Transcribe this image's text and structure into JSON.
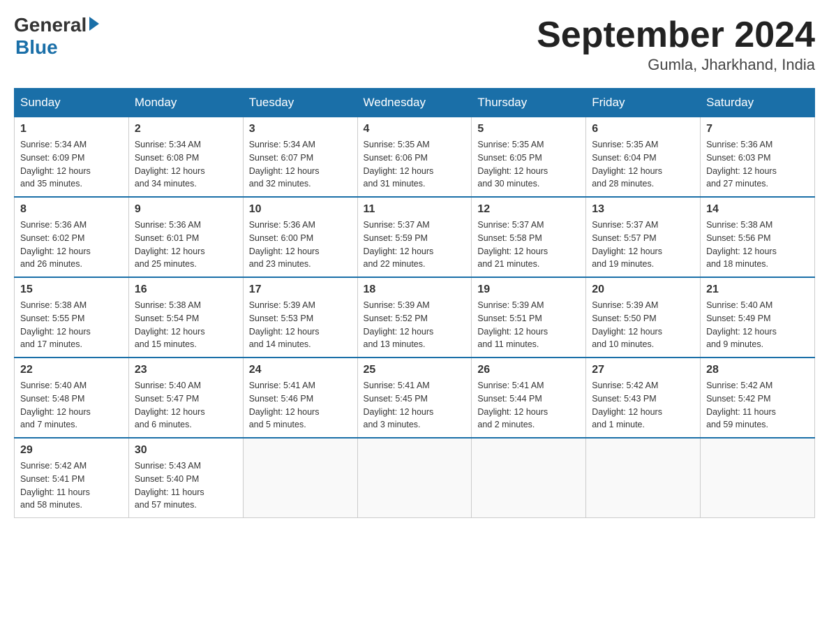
{
  "header": {
    "logo": {
      "general": "General",
      "blue": "Blue"
    },
    "title": "September 2024",
    "location": "Gumla, Jharkhand, India"
  },
  "days_of_week": [
    "Sunday",
    "Monday",
    "Tuesday",
    "Wednesday",
    "Thursday",
    "Friday",
    "Saturday"
  ],
  "weeks": [
    [
      {
        "day": "1",
        "sunrise": "5:34 AM",
        "sunset": "6:09 PM",
        "daylight": "12 hours and 35 minutes."
      },
      {
        "day": "2",
        "sunrise": "5:34 AM",
        "sunset": "6:08 PM",
        "daylight": "12 hours and 34 minutes."
      },
      {
        "day": "3",
        "sunrise": "5:34 AM",
        "sunset": "6:07 PM",
        "daylight": "12 hours and 32 minutes."
      },
      {
        "day": "4",
        "sunrise": "5:35 AM",
        "sunset": "6:06 PM",
        "daylight": "12 hours and 31 minutes."
      },
      {
        "day": "5",
        "sunrise": "5:35 AM",
        "sunset": "6:05 PM",
        "daylight": "12 hours and 30 minutes."
      },
      {
        "day": "6",
        "sunrise": "5:35 AM",
        "sunset": "6:04 PM",
        "daylight": "12 hours and 28 minutes."
      },
      {
        "day": "7",
        "sunrise": "5:36 AM",
        "sunset": "6:03 PM",
        "daylight": "12 hours and 27 minutes."
      }
    ],
    [
      {
        "day": "8",
        "sunrise": "5:36 AM",
        "sunset": "6:02 PM",
        "daylight": "12 hours and 26 minutes."
      },
      {
        "day": "9",
        "sunrise": "5:36 AM",
        "sunset": "6:01 PM",
        "daylight": "12 hours and 25 minutes."
      },
      {
        "day": "10",
        "sunrise": "5:36 AM",
        "sunset": "6:00 PM",
        "daylight": "12 hours and 23 minutes."
      },
      {
        "day": "11",
        "sunrise": "5:37 AM",
        "sunset": "5:59 PM",
        "daylight": "12 hours and 22 minutes."
      },
      {
        "day": "12",
        "sunrise": "5:37 AM",
        "sunset": "5:58 PM",
        "daylight": "12 hours and 21 minutes."
      },
      {
        "day": "13",
        "sunrise": "5:37 AM",
        "sunset": "5:57 PM",
        "daylight": "12 hours and 19 minutes."
      },
      {
        "day": "14",
        "sunrise": "5:38 AM",
        "sunset": "5:56 PM",
        "daylight": "12 hours and 18 minutes."
      }
    ],
    [
      {
        "day": "15",
        "sunrise": "5:38 AM",
        "sunset": "5:55 PM",
        "daylight": "12 hours and 17 minutes."
      },
      {
        "day": "16",
        "sunrise": "5:38 AM",
        "sunset": "5:54 PM",
        "daylight": "12 hours and 15 minutes."
      },
      {
        "day": "17",
        "sunrise": "5:39 AM",
        "sunset": "5:53 PM",
        "daylight": "12 hours and 14 minutes."
      },
      {
        "day": "18",
        "sunrise": "5:39 AM",
        "sunset": "5:52 PM",
        "daylight": "12 hours and 13 minutes."
      },
      {
        "day": "19",
        "sunrise": "5:39 AM",
        "sunset": "5:51 PM",
        "daylight": "12 hours and 11 minutes."
      },
      {
        "day": "20",
        "sunrise": "5:39 AM",
        "sunset": "5:50 PM",
        "daylight": "12 hours and 10 minutes."
      },
      {
        "day": "21",
        "sunrise": "5:40 AM",
        "sunset": "5:49 PM",
        "daylight": "12 hours and 9 minutes."
      }
    ],
    [
      {
        "day": "22",
        "sunrise": "5:40 AM",
        "sunset": "5:48 PM",
        "daylight": "12 hours and 7 minutes."
      },
      {
        "day": "23",
        "sunrise": "5:40 AM",
        "sunset": "5:47 PM",
        "daylight": "12 hours and 6 minutes."
      },
      {
        "day": "24",
        "sunrise": "5:41 AM",
        "sunset": "5:46 PM",
        "daylight": "12 hours and 5 minutes."
      },
      {
        "day": "25",
        "sunrise": "5:41 AM",
        "sunset": "5:45 PM",
        "daylight": "12 hours and 3 minutes."
      },
      {
        "day": "26",
        "sunrise": "5:41 AM",
        "sunset": "5:44 PM",
        "daylight": "12 hours and 2 minutes."
      },
      {
        "day": "27",
        "sunrise": "5:42 AM",
        "sunset": "5:43 PM",
        "daylight": "12 hours and 1 minute."
      },
      {
        "day": "28",
        "sunrise": "5:42 AM",
        "sunset": "5:42 PM",
        "daylight": "11 hours and 59 minutes."
      }
    ],
    [
      {
        "day": "29",
        "sunrise": "5:42 AM",
        "sunset": "5:41 PM",
        "daylight": "11 hours and 58 minutes."
      },
      {
        "day": "30",
        "sunrise": "5:43 AM",
        "sunset": "5:40 PM",
        "daylight": "11 hours and 57 minutes."
      },
      null,
      null,
      null,
      null,
      null
    ]
  ],
  "labels": {
    "sunrise": "Sunrise:",
    "sunset": "Sunset:",
    "daylight": "Daylight:"
  }
}
